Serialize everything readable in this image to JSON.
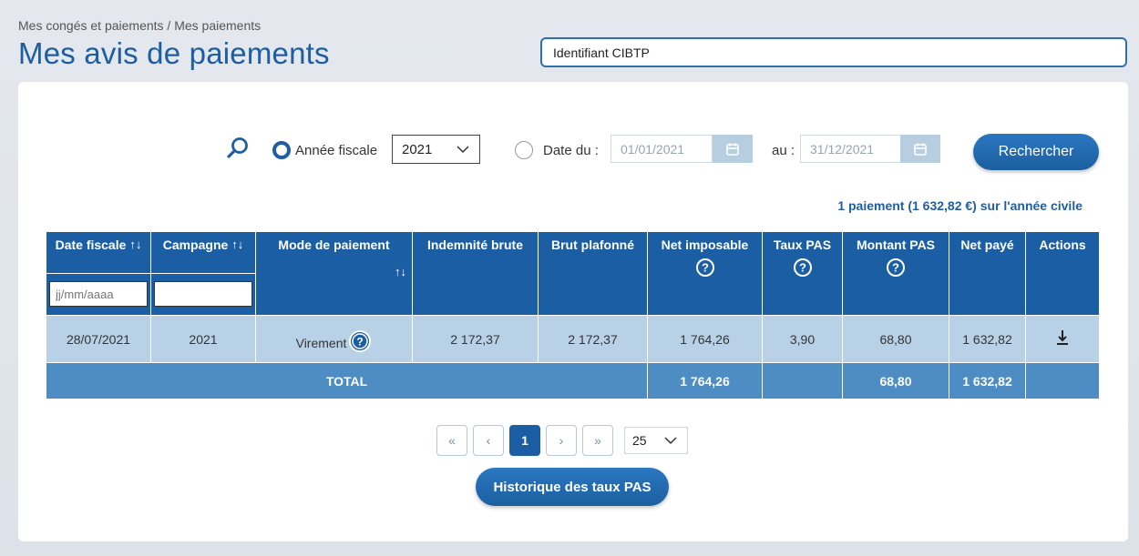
{
  "breadcrumb": "Mes congés et paiements / Mes paiements",
  "page_title": "Mes avis de paiements",
  "cibtp_field": {
    "value": "Identifiant CIBTP"
  },
  "filters": {
    "fiscal_year_label": "Année fiscale",
    "fiscal_year_value": "2021",
    "date_from_label": "Date du :",
    "date_from_value": "01/01/2021",
    "date_to_label": "au :",
    "date_to_value": "31/12/2021",
    "search_button": "Rechercher",
    "selected_mode": "fiscal_year"
  },
  "summary": "1 paiement (1 632,82 €) sur l'année civile",
  "table": {
    "columns": [
      {
        "key": "date_fiscale",
        "label": "Date fiscale",
        "sortable": true
      },
      {
        "key": "campagne",
        "label": "Campagne",
        "sortable": true
      },
      {
        "key": "mode_paiement",
        "label": "Mode de paiement",
        "sortable": true
      },
      {
        "key": "indemnite_brute",
        "label": "Indemnité brute"
      },
      {
        "key": "brut_plafonne",
        "label": "Brut plafonné"
      },
      {
        "key": "net_imposable",
        "label": "Net imposable",
        "help": true
      },
      {
        "key": "taux_pas",
        "label": "Taux PAS",
        "help": true
      },
      {
        "key": "montant_pas",
        "label": "Montant PAS",
        "help": true
      },
      {
        "key": "net_paye",
        "label": "Net payé"
      },
      {
        "key": "actions",
        "label": "Actions"
      }
    ],
    "filter_date_placeholder": "jj/mm/aaaa",
    "filter_campagne_placeholder": "",
    "rows": [
      {
        "date_fiscale": "28/07/2021",
        "campagne": "2021",
        "mode_paiement": "Virement",
        "indemnite_brute": "2 172,37",
        "brut_plafonne": "2 172,37",
        "net_imposable": "1 764,26",
        "taux_pas": "3,90",
        "montant_pas": "68,80",
        "net_paye": "1 632,82"
      }
    ],
    "total": {
      "label": "TOTAL",
      "net_imposable": "1 764,26",
      "montant_pas": "68,80",
      "net_paye": "1 632,82"
    }
  },
  "pagination": {
    "first": "«",
    "prev": "‹",
    "current": "1",
    "next": "›",
    "last": "»",
    "per_page": "25"
  },
  "history_button": "Historique des taux PAS",
  "colors": {
    "primary": "#1c5ea4",
    "row_bg": "#b9d1e6",
    "total_bg": "#4d8dc4",
    "title": "#1e5ea0"
  }
}
